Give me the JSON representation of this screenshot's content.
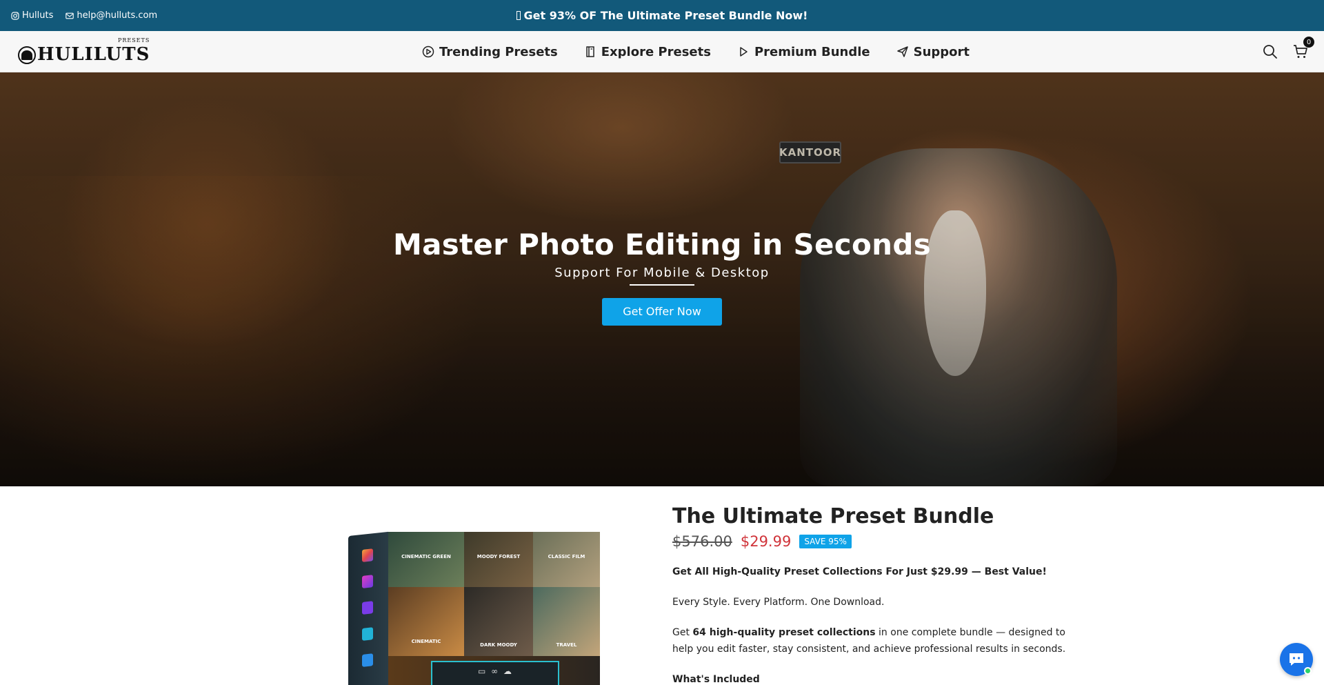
{
  "topbar": {
    "instagram": "Hulluts",
    "email": "help@hulluts.com",
    "promo": "Get 93% OF The Ultimate Preset Bundle Now!",
    "bg_color": "#12597a"
  },
  "header": {
    "logo_text": "HULILUTS",
    "logo_tag": "PRESETS",
    "nav": [
      {
        "label": "Trending Presets",
        "icon": "play-circle-icon"
      },
      {
        "label": "Explore Presets",
        "icon": "book-icon"
      },
      {
        "label": "Premium Bundle",
        "icon": "play-icon"
      },
      {
        "label": "Support",
        "icon": "send-icon"
      }
    ],
    "cart_count": "0"
  },
  "hero": {
    "title": "Master Photo Editing in Seconds",
    "subtitle": "Support For Mobile & Desktop",
    "cta": "Get Offer Now",
    "sign": "KANTOOR",
    "cta_color": "#0fa3e8"
  },
  "product": {
    "title": "The Ultimate Preset Bundle",
    "price_old": "$576.00",
    "price_new": "$29.99",
    "save_badge": "SAVE 95%",
    "lead": "Get All High-Quality Preset Collections For Just $29.99 — Best Value!",
    "tagline": "Every Style. Every Platform. One Download.",
    "get_pre": "Get ",
    "get_bold": "64 high-quality preset collections",
    "get_post": " in one complete bundle — designed to help you edit faster, stay consistent, and achieve professional results in seconds.",
    "included": "What's Included",
    "box_labels": [
      "CINEMATIC GREEN",
      "MOODY FOREST",
      "CLASSIC FILM",
      "CINEMATIC",
      "DARK MOODY",
      "TRAVEL"
    ],
    "price_new_color": "#d0343a"
  }
}
